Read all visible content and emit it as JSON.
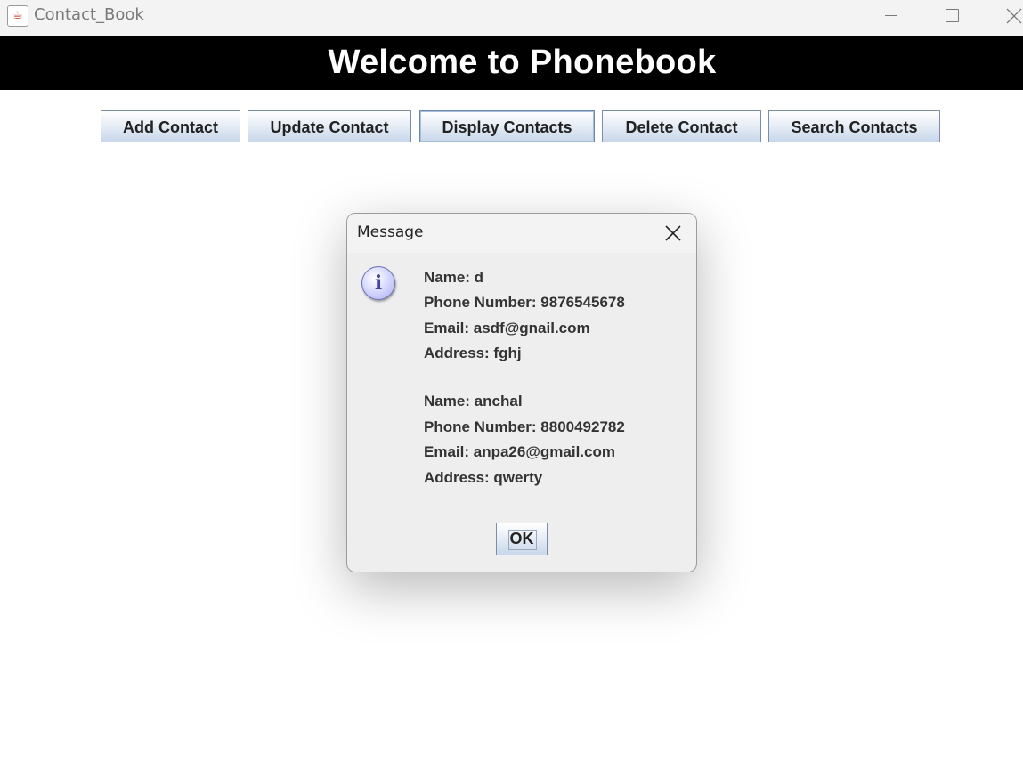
{
  "window": {
    "title": "Contact_Book",
    "app_icon": "java-icon"
  },
  "banner": {
    "text": "Welcome to Phonebook"
  },
  "toolbar": {
    "add_label": "Add Contact",
    "update_label": "Update Contact",
    "display_label": "Display Contacts",
    "delete_label": "Delete Contact",
    "search_label": "Search Contacts"
  },
  "dialog": {
    "title": "Message",
    "icon": "info-icon",
    "lines": [
      "Name: d",
      "Phone Number: 9876545678",
      "Email: asdf@gnail.com",
      "Address: fghj",
      "Name: anchal",
      "Phone Number: 8800492782",
      "Email: anpa26@gmail.com",
      "Address: qwerty"
    ],
    "ok_label": "OK"
  },
  "colors": {
    "banner_bg": "#000000",
    "banner_fg": "#ffffff",
    "dialog_bg": "#eeeeee",
    "info_icon": "#a9adf2"
  }
}
